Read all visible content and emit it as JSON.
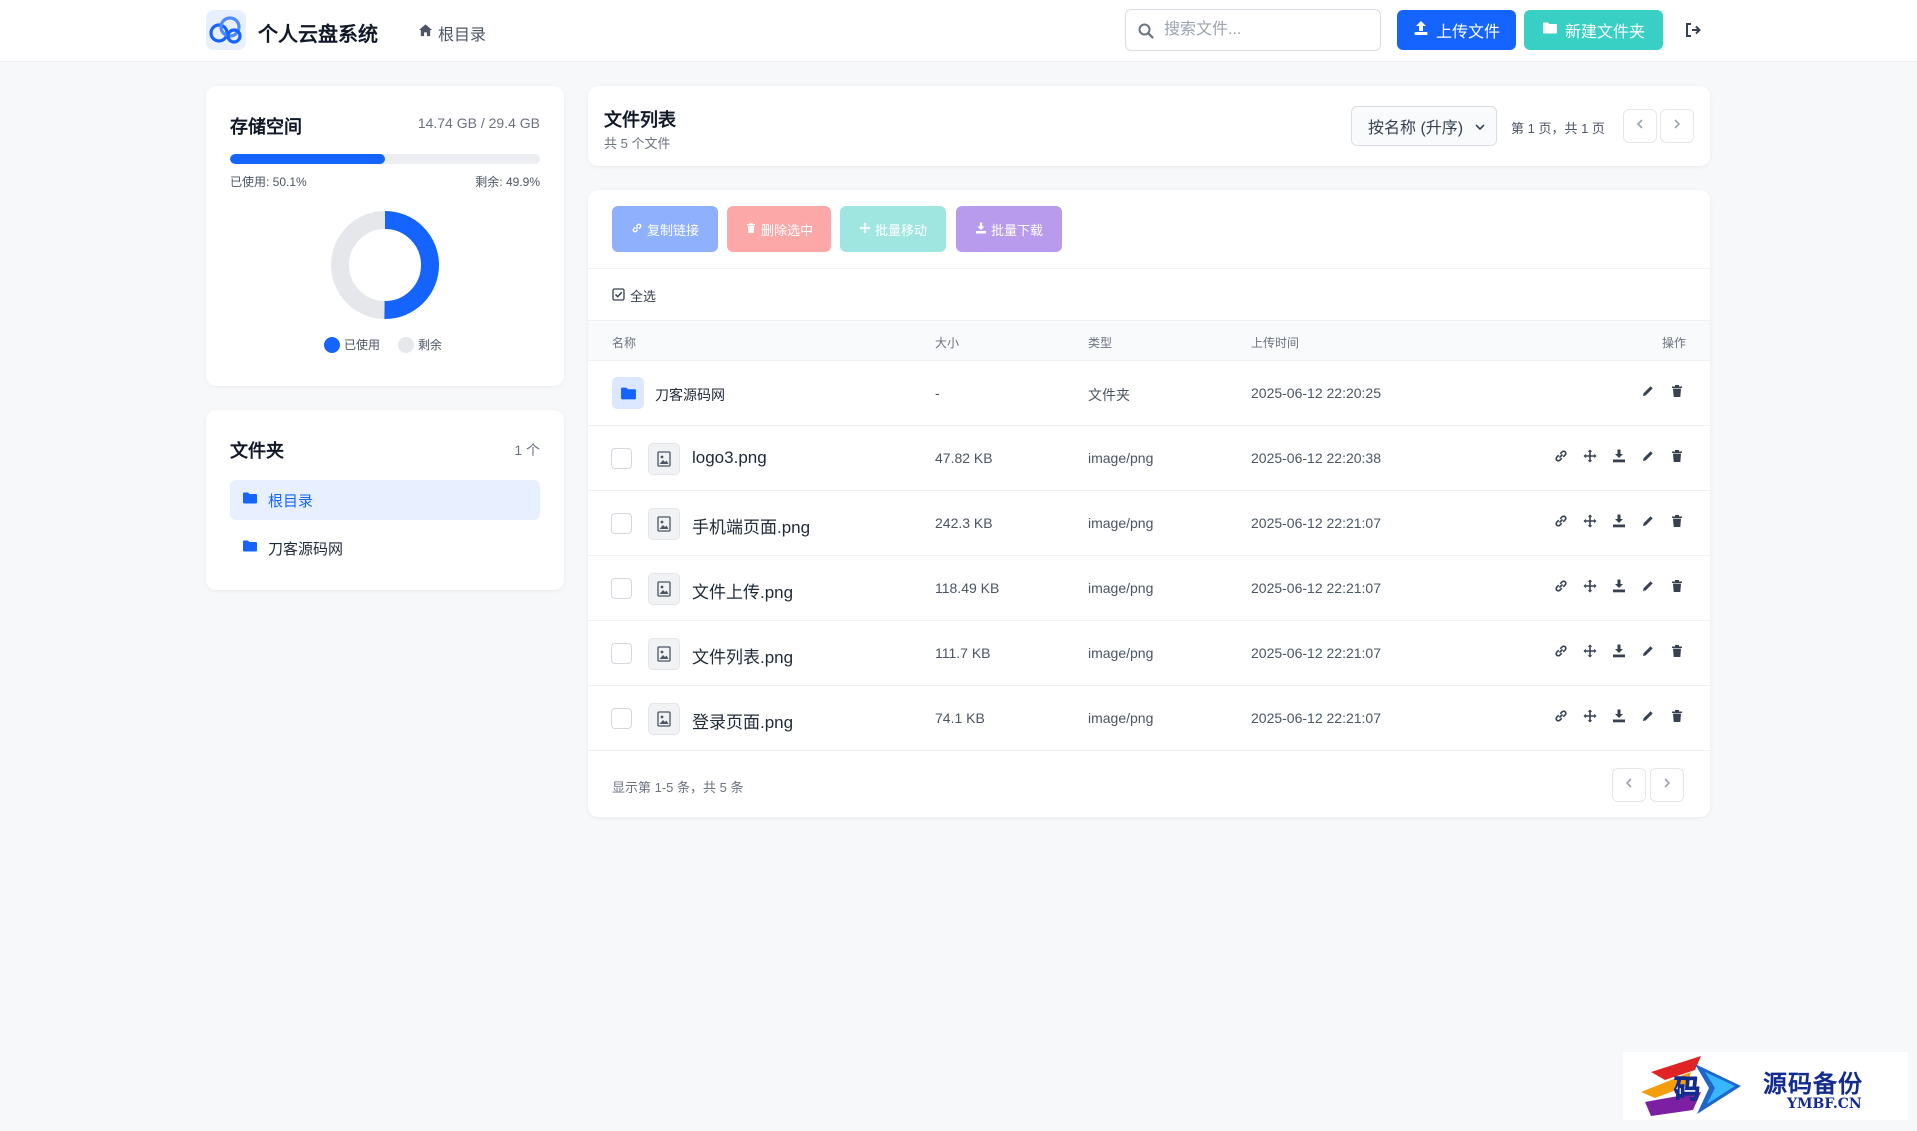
{
  "header": {
    "app_title": "个人云盘系统",
    "breadcrumb": "根目录",
    "search_placeholder": "搜索文件...",
    "upload_label": "上传文件",
    "new_folder_label": "新建文件夹"
  },
  "storage": {
    "title": "存储空间",
    "amount": "14.74 GB / 29.4 GB",
    "used_percent": 50.1,
    "used_label": "已使用: 50.1%",
    "free_label": "剩余: 49.9%",
    "legend_used": "已使用",
    "legend_free": "剩余",
    "used_color": "#1664ff",
    "free_color": "#e5e7eb"
  },
  "folders": {
    "title": "文件夹",
    "count": "1 个",
    "items": [
      {
        "label": "根目录",
        "active": true
      },
      {
        "label": "刀客源码网",
        "active": false
      }
    ]
  },
  "file_list": {
    "title": "文件列表",
    "subtitle": "共 5 个文件",
    "sort_value": "按名称 (升序)",
    "page_info": "第 1 页，共 1 页"
  },
  "bulk_actions": {
    "copy_link": "复制链接",
    "delete_selected": "删除选中",
    "batch_move": "批量移动",
    "batch_download": "批量下载"
  },
  "table": {
    "select_all": "全选",
    "headers": {
      "name": "名称",
      "size": "大小",
      "type": "类型",
      "time": "上传时间",
      "actions": "操作"
    },
    "rows": [
      {
        "name": "刀客源码网",
        "size": "-",
        "type": "文件夹",
        "time": "2025-06-12 22:20:25",
        "is_folder": true
      },
      {
        "name": "logo3.png",
        "size": "47.82 KB",
        "type": "image/png",
        "time": "2025-06-12 22:20:38",
        "is_folder": false
      },
      {
        "name": "手机端页面.png",
        "size": "242.3 KB",
        "type": "image/png",
        "time": "2025-06-12 22:21:07",
        "is_folder": false
      },
      {
        "name": "文件上传.png",
        "size": "118.49 KB",
        "type": "image/png",
        "time": "2025-06-12 22:21:07",
        "is_folder": false
      },
      {
        "name": "文件列表.png",
        "size": "111.7 KB",
        "type": "image/png",
        "time": "2025-06-12 22:21:07",
        "is_folder": false
      },
      {
        "name": "登录页面.png",
        "size": "74.1 KB",
        "type": "image/png",
        "time": "2025-06-12 22:21:07",
        "is_folder": false
      }
    ],
    "footer_info": "显示第 1-5 条，共 5 条"
  },
  "watermark": {
    "name": "源码备份",
    "domain": "YMBF.CN",
    "glyph": "码"
  }
}
